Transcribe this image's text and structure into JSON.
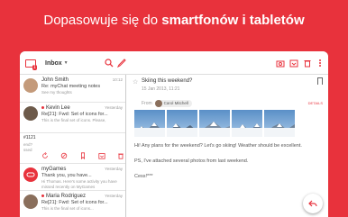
{
  "headline": {
    "prefix": "Dopasowuje się do ",
    "bold": "smartfonów i tabletów"
  },
  "toolbar": {
    "folder": "Inbox"
  },
  "list": {
    "items": [
      {
        "sender": "John Smith",
        "subject": "Re: myChat meeting notes",
        "snippet": "See my thoughts",
        "time": "10:12",
        "unread": false
      },
      {
        "sender": "Kevin Lee",
        "subject": "Re[21]: Fwd: Set of icons for...",
        "snippet": "This is the final set of icons. Please,",
        "time": "Yesterday",
        "unread": true
      },
      {
        "sender": "myGames",
        "subject": "Thank you, you have...",
        "snippet": "Hi Thomas. Here's some activity you have missed recently on MyGames",
        "time": "Yesterday",
        "unread": false
      },
      {
        "sender": "Maria Rodriguez",
        "subject": "Re[21]: Fwd: Set of icons for...",
        "snippet": "This is the final set of icons...",
        "time": "Yesterday",
        "unread": true
      }
    ],
    "swipe": {
      "tag": "#1121",
      "fragment1": "end?",
      "fragment2": "ssed"
    }
  },
  "detail": {
    "subject": "Skiing this weekend?",
    "date": "15 Jan 2013, 11:21",
    "from_label": "From",
    "from_name": "Carol Mitchell",
    "details_label": "DETAILS",
    "paragraphs": [
      "Hi! Any plans for the weekend? Let's go skiing! Weather should be excellent.",
      "PS, I've attached several photos from last weekend.",
      "Cess!***"
    ]
  }
}
